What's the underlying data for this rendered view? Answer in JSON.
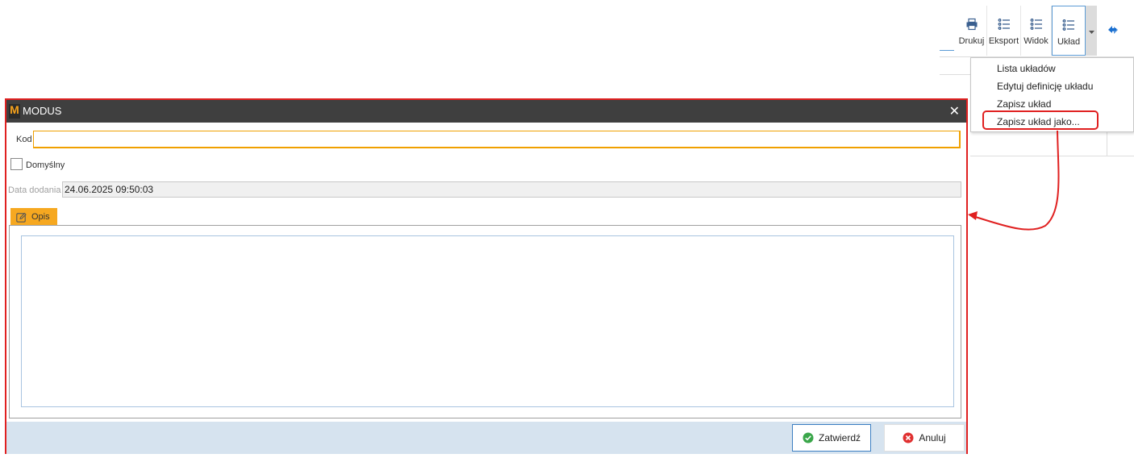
{
  "toolbar": {
    "print_label": "Drukuj",
    "export_label": "Eksport",
    "view_label": "Widok",
    "layout_label": "Układ"
  },
  "layout_menu": {
    "items": [
      "Lista układów",
      "Edytuj definicję układu",
      "Zapisz układ",
      "Zapisz układ jako..."
    ]
  },
  "dialog": {
    "title": "MODUS",
    "logo_letter": "M",
    "close_glyph": "✕",
    "kod_label": "Kod",
    "kod_value": "",
    "default_label": "Domyślny",
    "default_checked": false,
    "date_label": "Data dodania",
    "date_value": "24.06.2025 09:50:03",
    "tab_label": "Opis",
    "description_value": "",
    "confirm_label": "Zatwierdź",
    "cancel_label": "Anuluj"
  },
  "colors": {
    "highlight": "#e02020",
    "tab_accent": "#f6a820",
    "titlebar": "#3f3f3f",
    "footer": "#d6e3ef"
  }
}
